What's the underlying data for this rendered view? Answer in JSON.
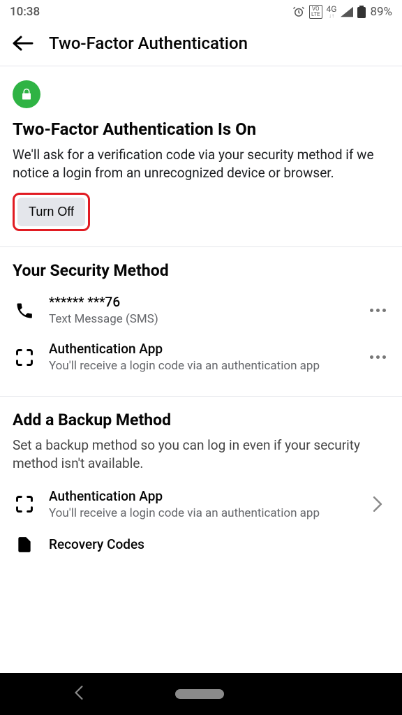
{
  "status": {
    "time": "10:38",
    "battery_pct": "89%",
    "network": "4G",
    "volte_top": "VO",
    "volte_bottom": "LTE"
  },
  "header": {
    "title": "Two-Factor Authentication"
  },
  "main": {
    "status_heading": "Two-Factor Authentication Is On",
    "status_body": "We'll ask for a verification code via your security method if we notice a login from an unrecognized device or browser.",
    "turn_off_label": "Turn Off"
  },
  "security": {
    "heading": "Your Security Method",
    "items": [
      {
        "title": "****** ***76",
        "subtitle": "Text Message (SMS)"
      },
      {
        "title": "Authentication App",
        "subtitle": "You'll receive a login code via an authentication app"
      }
    ]
  },
  "backup": {
    "heading": "Add a Backup Method",
    "body": "Set a backup method so you can log in even if your security method isn't available.",
    "items": [
      {
        "title": "Authentication App",
        "subtitle": "You'll receive a login code via an authentication app"
      },
      {
        "title": "Recovery Codes"
      }
    ]
  }
}
